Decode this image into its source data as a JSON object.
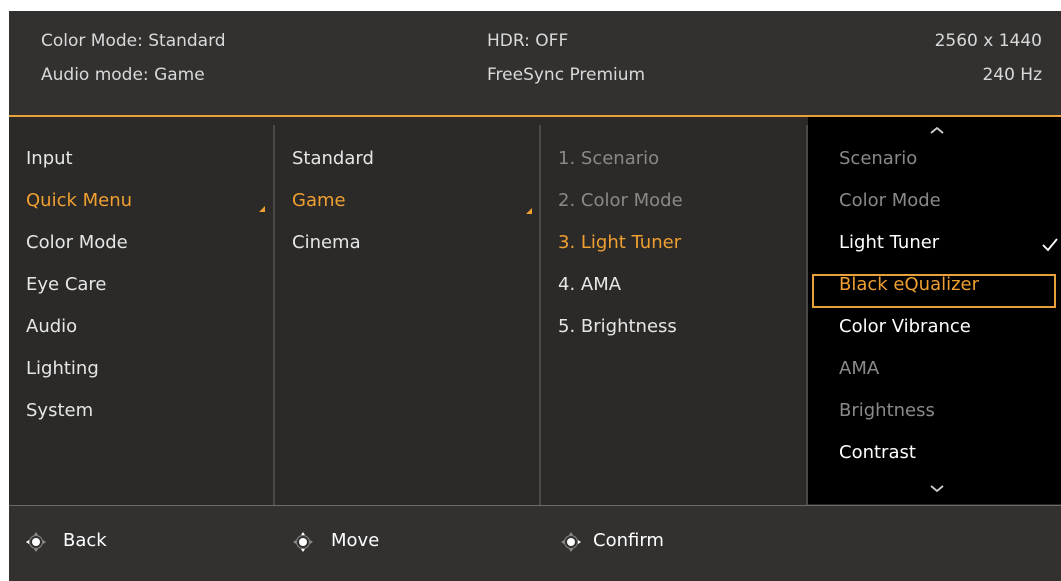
{
  "header": {
    "color_mode": "Color Mode: Standard",
    "audio_mode": "Audio mode: Game",
    "hdr": "HDR: OFF",
    "freesync": "FreeSync Premium",
    "resolution": "2560 x 1440",
    "refresh": "240 Hz"
  },
  "menu_l1": [
    "Input",
    "Quick Menu",
    "Color Mode",
    "Eye Care",
    "Audio",
    "Lighting",
    "System"
  ],
  "menu_l2": [
    "Standard",
    "Game",
    "Cinema"
  ],
  "menu_l3": [
    "1. Scenario",
    "2. Color Mode",
    "3. Light Tuner",
    "4. AMA",
    "5. Brightness"
  ],
  "menu_l4": [
    "Scenario",
    "Color Mode",
    "Light Tuner",
    "Black eQualizer",
    "Color Vibrance",
    "AMA",
    "Brightness",
    "Contrast"
  ],
  "footer": {
    "back": "Back",
    "move": "Move",
    "confirm": "Confirm"
  },
  "colors": {
    "accent": "#f0a030",
    "background": "#2b2a28",
    "panel": "#323130",
    "selected_column": "#000000"
  },
  "icons": [
    "chevron-up-icon",
    "chevron-down-icon",
    "checkmark-icon",
    "joystick-icon"
  ]
}
